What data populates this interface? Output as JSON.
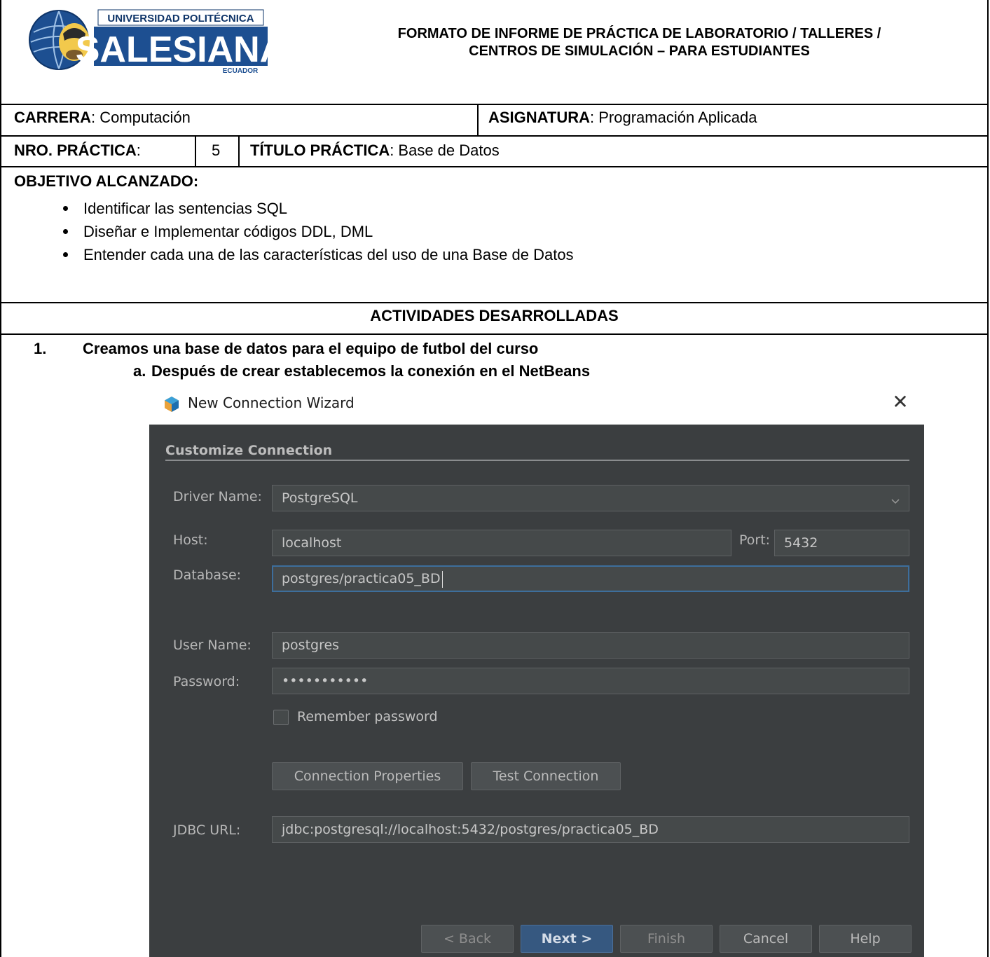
{
  "logo": {
    "top_text": "UNIVERSIDAD POLITÉCNICA",
    "main_text": "SALESIANA",
    "sub_text": "ECUADOR"
  },
  "header": {
    "title_line1": "FORMATO DE INFORME DE PRÁCTICA DE LABORATORIO / TALLERES /",
    "title_line2": "CENTROS DE SIMULACIÓN – PARA ESTUDIANTES"
  },
  "info": {
    "carrera_label": "CARRERA",
    "carrera_value": ": Computación",
    "asignatura_label": "ASIGNATURA",
    "asignatura_value": ": Programación Aplicada",
    "nro_label": "NRO. PRÁCTICA",
    "nro_sep": ":",
    "nro_value": "5",
    "titulo_label": "TÍTULO PRÁCTICA",
    "titulo_value": ": Base de Datos"
  },
  "objetivo": {
    "heading": "OBJETIVO ALCANZADO:",
    "items": [
      "Identificar las sentencias SQL",
      "Diseñar e Implementar códigos DDL, DML",
      "Entender cada una de las características del uso de una Base de Datos"
    ]
  },
  "actividades": {
    "heading": "ACTIVIDADES DESARROLLADAS",
    "step1_num": "1.",
    "step1_text": "Creamos una base de datos para el equipo de futbol del curso",
    "step1a_num": "a.",
    "step1a_text": "Después de crear establecemos la conexión en el NetBeans"
  },
  "dialog": {
    "title": "New Connection Wizard",
    "close_glyph": "✕",
    "section": "Customize Connection",
    "driver_label": "Driver Name:",
    "driver_value": "PostgreSQL",
    "host_label": "Host:",
    "host_value": "localhost",
    "port_label": "Port:",
    "port_value": "5432",
    "database_label": "Database:",
    "database_value": "postgres/practica05_BD",
    "user_label": "User Name:",
    "user_value": "postgres",
    "password_label": "Password:",
    "password_value": "•••••••••••",
    "remember_label": "Remember password",
    "remember_checked": false,
    "conn_props_button": "Connection Properties",
    "test_button": "Test Connection",
    "jdbc_label": "JDBC URL:",
    "jdbc_value": "jdbc:postgresql://localhost:5432/postgres/practica05_BD",
    "back_button": "< Back",
    "next_button": "Next >",
    "finish_button": "Finish",
    "cancel_button": "Cancel",
    "help_button": "Help",
    "colors": {
      "background": "#3b3e40",
      "field": "#45494a",
      "primary": "#365880",
      "focus_border": "#3d6e9c"
    }
  }
}
